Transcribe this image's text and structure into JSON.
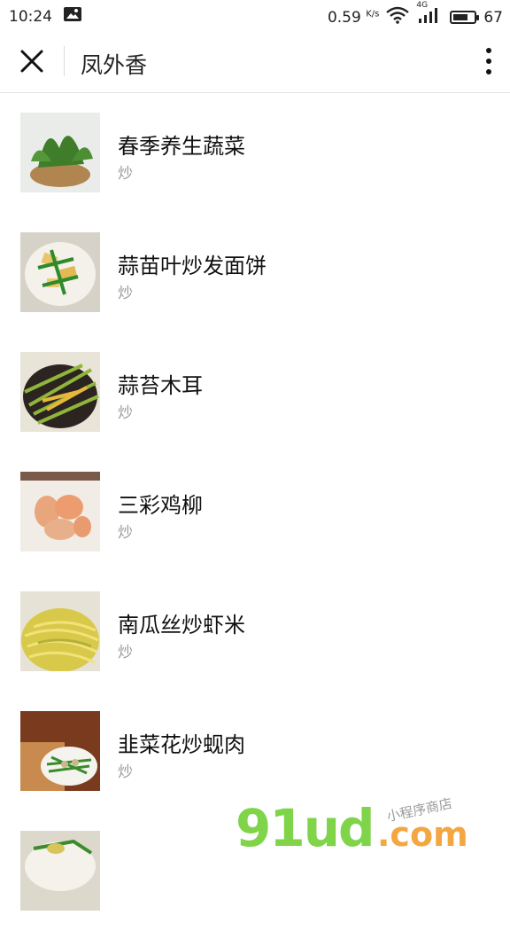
{
  "status_bar": {
    "time": "10:24",
    "net_speed_value": "0.59",
    "net_speed_unit": "K/s",
    "network_type": "4G",
    "battery": "67",
    "icons": [
      "image-notification-icon",
      "wifi-icon",
      "signal-icon",
      "battery-icon"
    ]
  },
  "nav": {
    "title": "凤外香",
    "close_icon": "close-icon",
    "more_icon": "more-vertical-icon"
  },
  "recipes": [
    {
      "title": "春季养生蔬菜",
      "method": "炒"
    },
    {
      "title": "蒜苗叶炒发面饼",
      "method": "炒"
    },
    {
      "title": "蒜苔木耳",
      "method": "炒"
    },
    {
      "title": "三彩鸡柳",
      "method": "炒"
    },
    {
      "title": "南瓜丝炒虾米",
      "method": "炒"
    },
    {
      "title": "韭菜花炒蚬肉",
      "method": "炒"
    },
    {
      "title": "",
      "method": ""
    }
  ],
  "watermark": {
    "brand": "91ud",
    "domain": ".com",
    "tagline": "小程序商店"
  },
  "colors": {
    "watermark_green": "#7fd44a",
    "watermark_orange": "#f4a640",
    "subtitle_gray": "#9a9a9a"
  }
}
